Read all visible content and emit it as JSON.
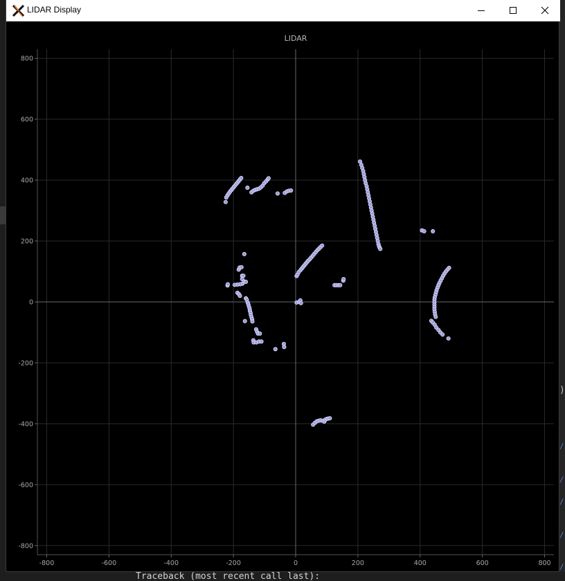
{
  "window": {
    "title": "LIDAR Display",
    "controls": {
      "minimize": "minimize",
      "maximize": "maximize",
      "close": "close"
    }
  },
  "background": {
    "terminal_text": "Traceback (most recent call last):"
  },
  "chart_data": {
    "type": "scatter",
    "title": "LIDAR",
    "xlabel": "",
    "ylabel": "",
    "xlim": [
      -830,
      830
    ],
    "ylim": [
      -830,
      830
    ],
    "xticks": [
      -800,
      -600,
      -400,
      -200,
      0,
      200,
      400,
      600,
      800
    ],
    "yticks": [
      -800,
      -600,
      -400,
      -200,
      0,
      200,
      400,
      600,
      800
    ],
    "grid": true,
    "background_color": "#000000",
    "grid_color": "#2a2a2a",
    "axis_line_color": "#6a6a6a",
    "marker_fill": "#9a9ad2",
    "marker_edge": "#d8d8ff",
    "series": [
      {
        "points": [
          [
            -225,
            328
          ],
          [
            -223,
            343
          ],
          [
            -219,
            350
          ],
          [
            -215,
            356
          ],
          [
            -211,
            362
          ],
          [
            -207,
            367
          ],
          [
            -203,
            372
          ],
          [
            -199,
            377
          ],
          [
            -195,
            382
          ],
          [
            -191,
            387
          ],
          [
            -187,
            392
          ],
          [
            -183,
            397
          ],
          [
            -179,
            402
          ],
          [
            -175,
            407
          ],
          [
            -155,
            375
          ],
          [
            -142,
            360
          ],
          [
            -136,
            365
          ],
          [
            -130,
            368
          ],
          [
            -124,
            370
          ],
          [
            -118,
            372
          ],
          [
            -112,
            376
          ],
          [
            -106,
            382
          ],
          [
            -101,
            390
          ],
          [
            -95,
            396
          ],
          [
            -90,
            402
          ],
          [
            -87,
            406
          ],
          [
            -58,
            356
          ],
          [
            -35,
            358
          ],
          [
            -28,
            363
          ],
          [
            -22,
            365
          ],
          [
            -15,
            366
          ],
          [
            -165,
            157
          ],
          [
            -183,
            106
          ],
          [
            -180,
            113
          ],
          [
            -174,
            114
          ],
          [
            -172,
            86
          ],
          [
            -168,
            86
          ],
          [
            -172,
            75
          ],
          [
            -165,
            67
          ],
          [
            -160,
            66
          ],
          [
            -171,
            60
          ],
          [
            -178,
            58
          ],
          [
            -187,
            57
          ],
          [
            -196,
            56
          ],
          [
            -219,
            54
          ],
          [
            -218,
            58
          ],
          [
            -187,
            30
          ],
          [
            -182,
            25
          ],
          [
            -179,
            20
          ],
          [
            -160,
            12
          ],
          [
            -157,
            7
          ],
          [
            -154,
            -2
          ],
          [
            -152,
            -8
          ],
          [
            -150,
            -15
          ],
          [
            -148,
            -22
          ],
          [
            -147,
            -29
          ],
          [
            -145,
            -36
          ],
          [
            -144,
            -43
          ],
          [
            -142,
            -50
          ],
          [
            -140,
            -57
          ],
          [
            -139,
            -64
          ],
          [
            -163,
            -63
          ],
          [
            -127,
            -90
          ],
          [
            -124,
            -98
          ],
          [
            -121,
            -104
          ],
          [
            -115,
            -104
          ],
          [
            -136,
            -126
          ],
          [
            -135,
            -133
          ],
          [
            -126,
            -133
          ],
          [
            -118,
            -130
          ],
          [
            -110,
            -130
          ],
          [
            -65,
            -155
          ],
          [
            -38,
            -138
          ],
          [
            -37,
            -148
          ],
          [
            3,
            85
          ],
          [
            6,
            90
          ],
          [
            10,
            98
          ],
          [
            16,
            105
          ],
          [
            20,
            110
          ],
          [
            24,
            115
          ],
          [
            28,
            120
          ],
          [
            32,
            125
          ],
          [
            36,
            130
          ],
          [
            40,
            135
          ],
          [
            45,
            140
          ],
          [
            50,
            146
          ],
          [
            55,
            152
          ],
          [
            60,
            158
          ],
          [
            65,
            164
          ],
          [
            70,
            170
          ],
          [
            75,
            175
          ],
          [
            80,
            180
          ],
          [
            85,
            185
          ],
          [
            3,
            -2
          ],
          [
            11,
            0
          ],
          [
            15,
            5
          ],
          [
            17,
            -4
          ],
          [
            125,
            55
          ],
          [
            131,
            55
          ],
          [
            138,
            55
          ],
          [
            143,
            55
          ],
          [
            153,
            70
          ],
          [
            154,
            75
          ],
          [
            207,
            461
          ],
          [
            211,
            450
          ],
          [
            214,
            440
          ],
          [
            217,
            430
          ],
          [
            219,
            420
          ],
          [
            221,
            410
          ],
          [
            223,
            400
          ],
          [
            225,
            390
          ],
          [
            228,
            380
          ],
          [
            230,
            370
          ],
          [
            232,
            360
          ],
          [
            234,
            350
          ],
          [
            236,
            340
          ],
          [
            238,
            330
          ],
          [
            240,
            320
          ],
          [
            242,
            310
          ],
          [
            244,
            300
          ],
          [
            246,
            290
          ],
          [
            248,
            280
          ],
          [
            250,
            270
          ],
          [
            252,
            260
          ],
          [
            254,
            250
          ],
          [
            256,
            240
          ],
          [
            258,
            230
          ],
          [
            260,
            220
          ],
          [
            262,
            210
          ],
          [
            264,
            200
          ],
          [
            266,
            190
          ],
          [
            268,
            183
          ],
          [
            270,
            178
          ],
          [
            272,
            174
          ],
          [
            406,
            235
          ],
          [
            413,
            232
          ],
          [
            441,
            232
          ],
          [
            493,
            112
          ],
          [
            488,
            106
          ],
          [
            483,
            100
          ],
          [
            478,
            93
          ],
          [
            474,
            86
          ],
          [
            470,
            78
          ],
          [
            466,
            70
          ],
          [
            462,
            62
          ],
          [
            459,
            55
          ],
          [
            456,
            47
          ],
          [
            453,
            39
          ],
          [
            451,
            31
          ],
          [
            449,
            23
          ],
          [
            447,
            15
          ],
          [
            446,
            7
          ],
          [
            446,
            -1
          ],
          [
            446,
            -9
          ],
          [
            446,
            -17
          ],
          [
            446,
            -25
          ],
          [
            447,
            -33
          ],
          [
            448,
            -41
          ],
          [
            450,
            -49
          ],
          [
            436,
            -62
          ],
          [
            441,
            -68
          ],
          [
            447,
            -75
          ],
          [
            452,
            -84
          ],
          [
            459,
            -92
          ],
          [
            465,
            -100
          ],
          [
            472,
            -107
          ],
          [
            491,
            -120
          ],
          [
            56,
            -403
          ],
          [
            62,
            -397
          ],
          [
            68,
            -392
          ],
          [
            74,
            -390
          ],
          [
            80,
            -389
          ],
          [
            86,
            -390
          ],
          [
            92,
            -393
          ],
          [
            95,
            -387
          ],
          [
            100,
            -384
          ],
          [
            105,
            -383
          ],
          [
            110,
            -382
          ]
        ]
      }
    ]
  }
}
